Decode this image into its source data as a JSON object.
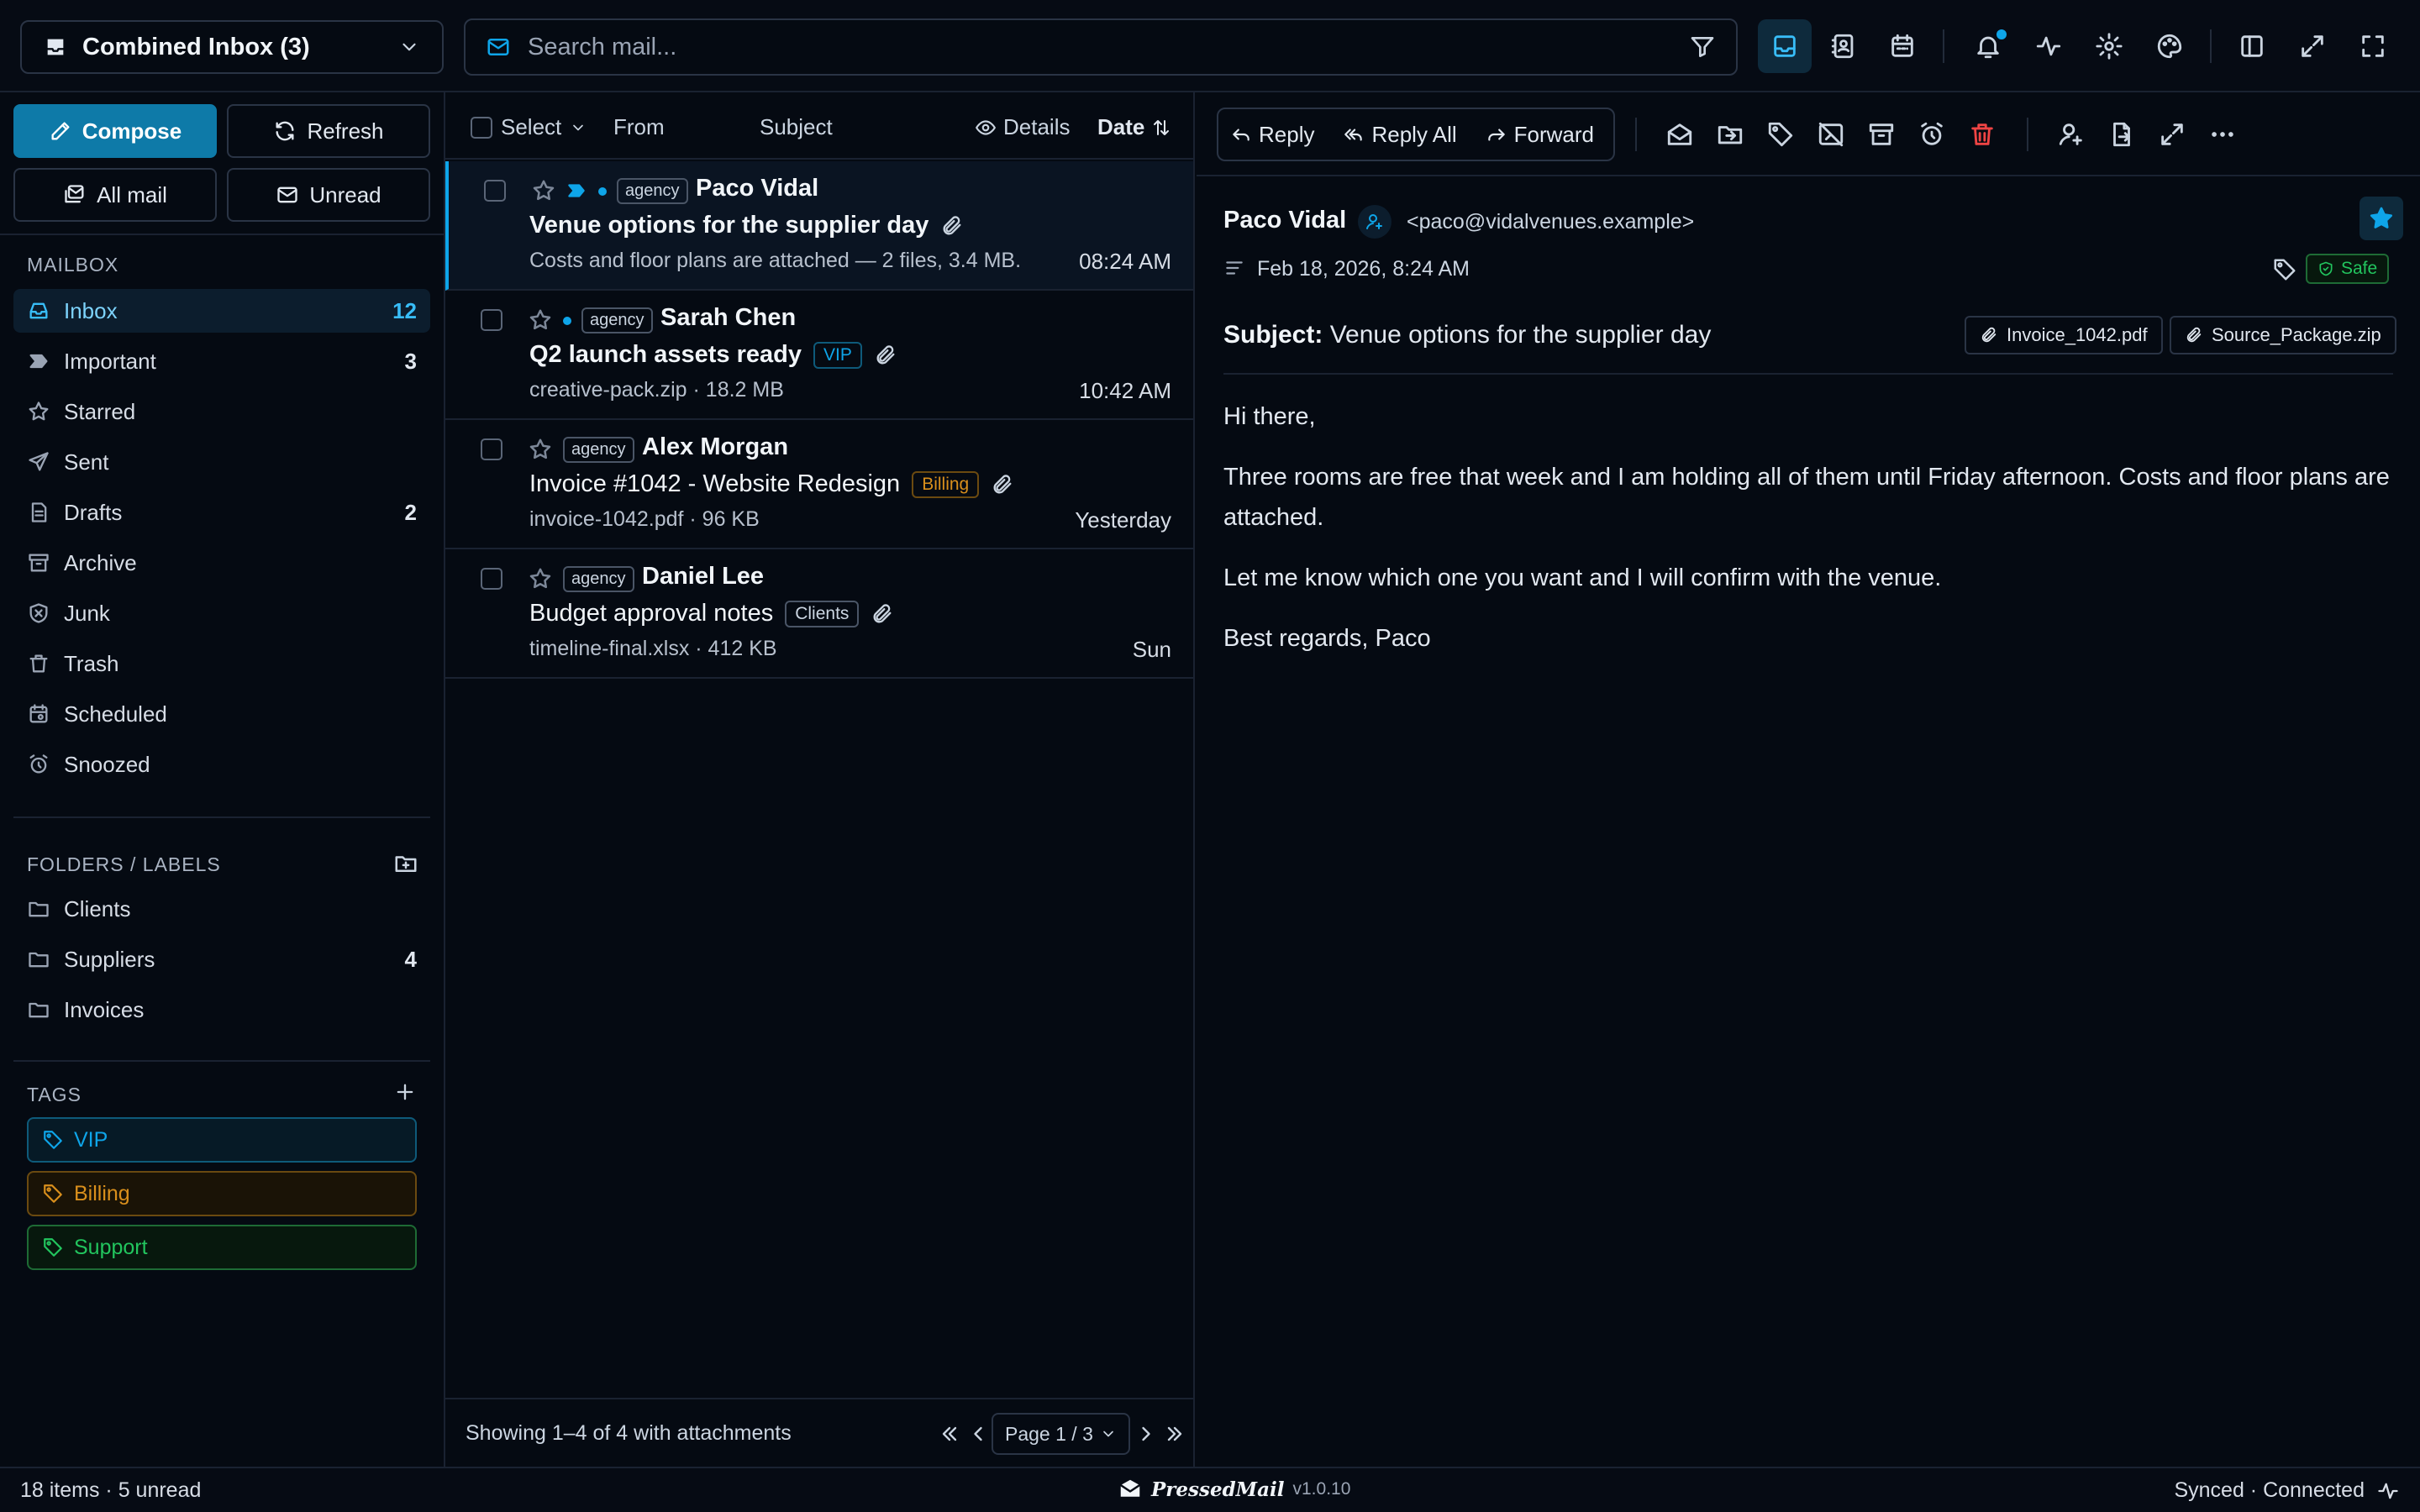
{
  "topbar": {
    "inbox_select": "Combined Inbox (3)",
    "search_placeholder": "Search mail..."
  },
  "sidebar": {
    "compose": "Compose",
    "refresh": "Refresh",
    "all_mail": "All mail",
    "unread": "Unread",
    "mailbox_title": "MAILBOX",
    "mailbox": [
      {
        "label": "Inbox",
        "count": "12",
        "icon": "inbox-icon"
      },
      {
        "label": "Important",
        "count": "3",
        "icon": "important-icon"
      },
      {
        "label": "Starred",
        "count": "",
        "icon": "star-icon"
      },
      {
        "label": "Sent",
        "count": "",
        "icon": "send-icon"
      },
      {
        "label": "Drafts",
        "count": "2",
        "icon": "drafts-icon"
      },
      {
        "label": "Archive",
        "count": "",
        "icon": "archive-icon"
      },
      {
        "label": "Junk",
        "count": "",
        "icon": "junk-icon"
      },
      {
        "label": "Trash",
        "count": "",
        "icon": "trash-icon"
      },
      {
        "label": "Scheduled",
        "count": "",
        "icon": "scheduled-icon"
      },
      {
        "label": "Snoozed",
        "count": "",
        "icon": "snooze-icon"
      }
    ],
    "folders_title": "FOLDERS / LABELS",
    "folders": [
      {
        "label": "Clients",
        "count": ""
      },
      {
        "label": "Suppliers",
        "count": "4"
      },
      {
        "label": "Invoices",
        "count": ""
      }
    ],
    "tags_title": "TAGS",
    "tags": [
      {
        "label": "VIP",
        "color": "#0ea5e9"
      },
      {
        "label": "Billing",
        "color": "#d98f1c"
      },
      {
        "label": "Support",
        "color": "#22c55e"
      }
    ]
  },
  "list": {
    "header": {
      "select": "Select",
      "from": "From",
      "subject": "Subject",
      "details": "Details",
      "date": "Date"
    },
    "messages": [
      {
        "badge": "agency",
        "sender": "Paco Vidal",
        "subject": "Venue options for the supplier day",
        "meta": "Costs and floor plans are attached — 2 files, 3.4 MB.",
        "time": "08:24 AM",
        "label": ""
      },
      {
        "badge": "agency",
        "sender": "Sarah Chen",
        "subject": "Q2 launch assets ready",
        "meta": "creative-pack.zip · 18.2 MB",
        "time": "10:42 AM",
        "label": "VIP"
      },
      {
        "badge": "agency",
        "sender": "Alex Morgan",
        "subject": "Invoice #1042 - Website Redesign",
        "meta": "invoice-1042.pdf · 96 KB",
        "time": "Yesterday",
        "label": "Billing"
      },
      {
        "badge": "agency",
        "sender": "Daniel Lee",
        "subject": "Budget approval notes",
        "meta": "timeline-final.xlsx · 412 KB",
        "time": "Sun",
        "label": "Clients"
      }
    ],
    "footer": {
      "showing": "Showing 1–4 of 4 with attachments",
      "page": "Page 1 / 3"
    }
  },
  "reader": {
    "actions": {
      "reply": "Reply",
      "reply_all": "Reply All",
      "forward": "Forward"
    },
    "from_name": "Paco Vidal",
    "from_email": "<paco@vidalvenues.example>",
    "date": "Feb 18, 2026, 8:24 AM",
    "safe": "Safe",
    "subject_label": "Subject:",
    "subject": "Venue options for the supplier day",
    "attachments": [
      "Invoice_1042.pdf",
      "Source_Package.zip"
    ],
    "body": [
      "Hi there,",
      "Three rooms are free that week and I am holding all of them until Friday afternoon. Costs and floor plans are attached.",
      "Let me know which one you want and I will confirm with the venue.",
      "Best regards, Paco"
    ]
  },
  "status": {
    "left": "18 items · 5 unread",
    "brand": "PressedMail",
    "version": "v1.0.10",
    "right": "Synced · Connected"
  },
  "colors": {
    "accent": "#0ea5e9",
    "danger": "#ef4444",
    "safe": "#22c55e"
  }
}
